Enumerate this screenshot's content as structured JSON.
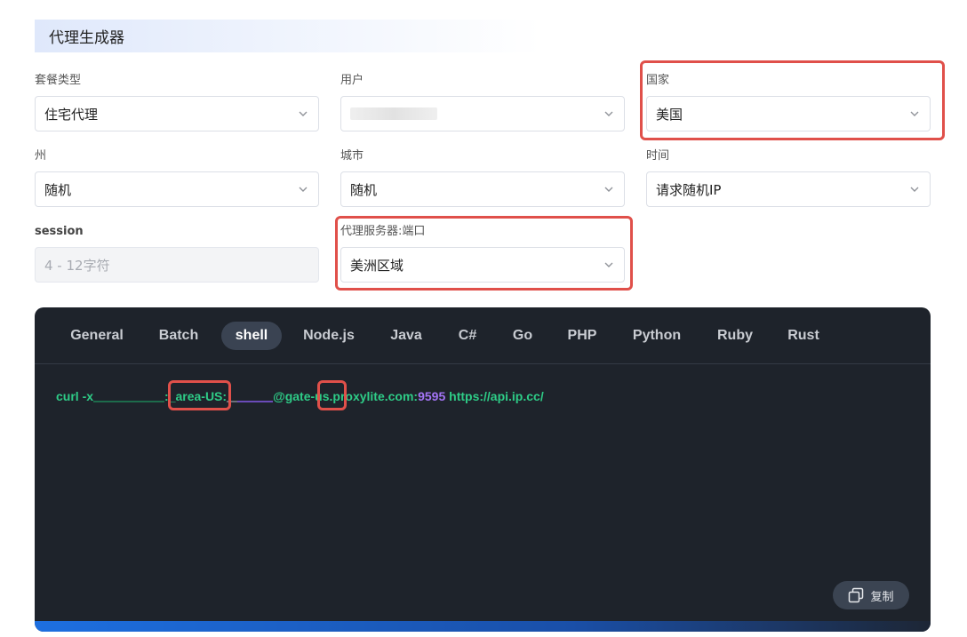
{
  "title": "代理生成器",
  "fields": {
    "package_type": {
      "label": "套餐类型",
      "value": "住宅代理"
    },
    "user": {
      "label": "用户",
      "value": ""
    },
    "country": {
      "label": "国家",
      "value": "美国"
    },
    "state": {
      "label": "州",
      "value": "随机"
    },
    "city": {
      "label": "城市",
      "value": "随机"
    },
    "time": {
      "label": "时间",
      "value": "请求随机IP"
    },
    "session": {
      "label": "session",
      "placeholder": "4 - 12字符"
    },
    "proxy_server": {
      "label": "代理服务器:端口",
      "value": "美洲区域"
    }
  },
  "tabs": [
    {
      "label": "General"
    },
    {
      "label": "Batch"
    },
    {
      "label": "shell"
    },
    {
      "label": "Node.js"
    },
    {
      "label": "Java"
    },
    {
      "label": "C#"
    },
    {
      "label": "Go"
    },
    {
      "label": "PHP"
    },
    {
      "label": "Python"
    },
    {
      "label": "Ruby"
    },
    {
      "label": "Rust"
    }
  ],
  "active_tab": "shell",
  "code": {
    "cmd": "curl -x",
    "colon": ":",
    "area": "_area-US",
    "sep": ":",
    "host_prefix": "@gate",
    "region": "-us",
    "host_suffix": ".proxylite.com:",
    "port": "9595",
    "url": " https://api.ip.cc/"
  },
  "copy_label": "复制",
  "colors": {
    "accent_highlight": "#e0504a",
    "code_bg": "#1e232b",
    "code_green": "#2ecc87",
    "code_purple": "#a374f5"
  }
}
